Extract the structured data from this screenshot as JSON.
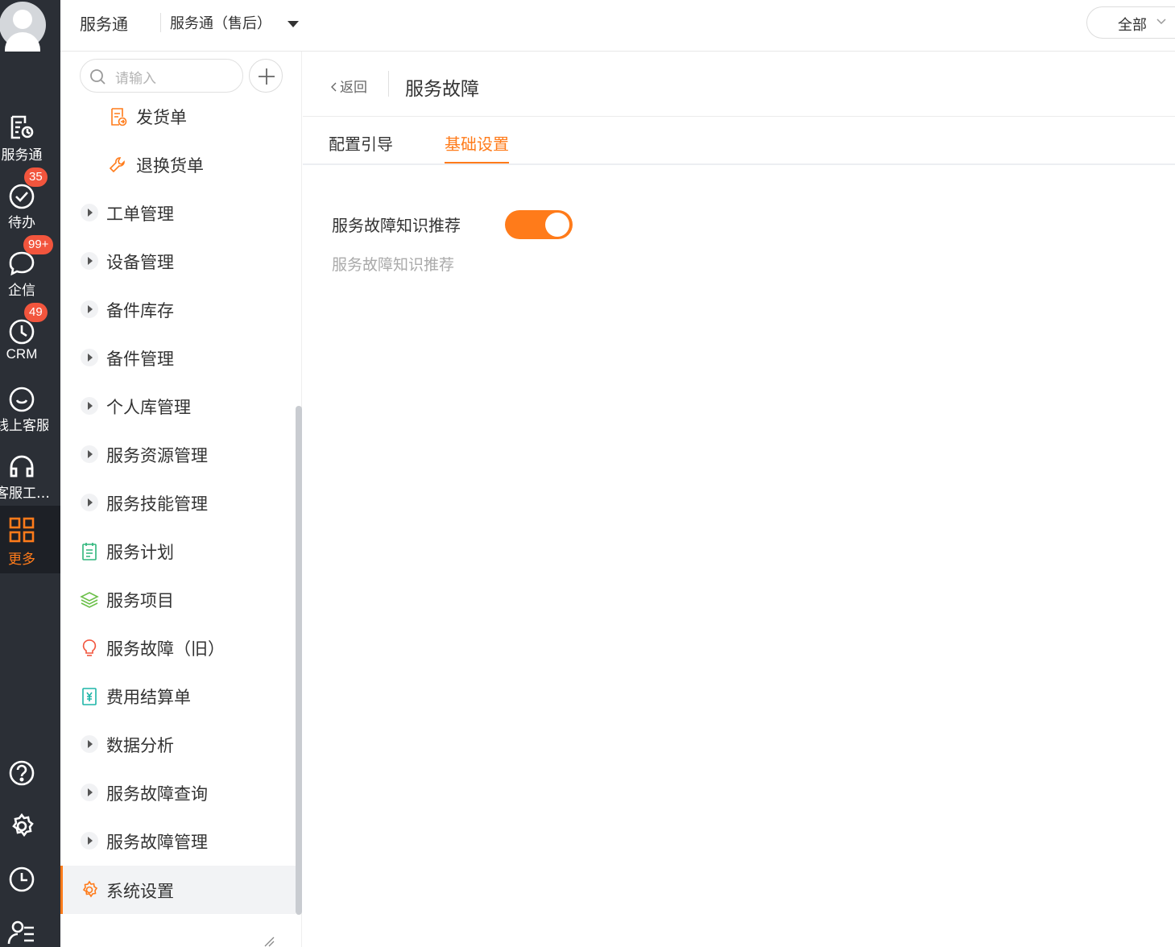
{
  "rail": {
    "items": [
      {
        "label": "服务通",
        "icon": "service-doc-icon"
      },
      {
        "label": "待办",
        "icon": "check-circle-icon",
        "badge": "35"
      },
      {
        "label": "企信",
        "icon": "chat-bubble-icon",
        "badge": "99+"
      },
      {
        "label": "CRM",
        "icon": "clock-crm-icon",
        "badge": "49"
      },
      {
        "label": "线上客服",
        "icon": "smile-chat-icon"
      },
      {
        "label": "客服工…",
        "icon": "headset-icon"
      },
      {
        "label": "更多",
        "icon": "grid-more-icon",
        "active": true
      }
    ],
    "bottom": [
      "help-icon",
      "settings-icon",
      "history-icon",
      "contacts-icon"
    ]
  },
  "header": {
    "app_title": "服务通",
    "app_select": "服务通（售后）",
    "scope": "全部"
  },
  "sidenav": {
    "search_placeholder": "请输入",
    "items": [
      {
        "label": "发货单",
        "kind": "sub",
        "icon": "invoice-icon"
      },
      {
        "label": "退换货单",
        "kind": "sub",
        "icon": "wrench-icon"
      },
      {
        "label": "工单管理",
        "kind": "group"
      },
      {
        "label": "设备管理",
        "kind": "group"
      },
      {
        "label": "备件库存",
        "kind": "group"
      },
      {
        "label": "备件管理",
        "kind": "group"
      },
      {
        "label": "个人库管理",
        "kind": "group"
      },
      {
        "label": "服务资源管理",
        "kind": "group"
      },
      {
        "label": "服务技能管理",
        "kind": "group"
      },
      {
        "label": "服务计划",
        "kind": "leaf",
        "icon": "calendar-list-icon"
      },
      {
        "label": "服务项目",
        "kind": "leaf",
        "icon": "layers-icon"
      },
      {
        "label": "服务故障（旧）",
        "kind": "leaf",
        "icon": "bulb-icon"
      },
      {
        "label": "费用结算单",
        "kind": "leaf",
        "icon": "yuan-doc-icon"
      },
      {
        "label": "数据分析",
        "kind": "group"
      },
      {
        "label": "服务故障查询",
        "kind": "group"
      },
      {
        "label": "服务故障管理",
        "kind": "group"
      },
      {
        "label": "系统设置",
        "kind": "leaf",
        "icon": "gear-icon",
        "selected": true
      }
    ]
  },
  "main": {
    "back_label": "返回",
    "title": "服务故障",
    "tabs": [
      {
        "label": "配置引导",
        "active": false
      },
      {
        "label": "基础设置",
        "active": true
      }
    ],
    "setting": {
      "label": "服务故障知识推荐",
      "enabled": true,
      "description": "服务故障知识推荐"
    }
  },
  "colors": {
    "accent": "#ff7b1a",
    "rail_bg": "#2b2f36",
    "badge": "#f2553d"
  }
}
